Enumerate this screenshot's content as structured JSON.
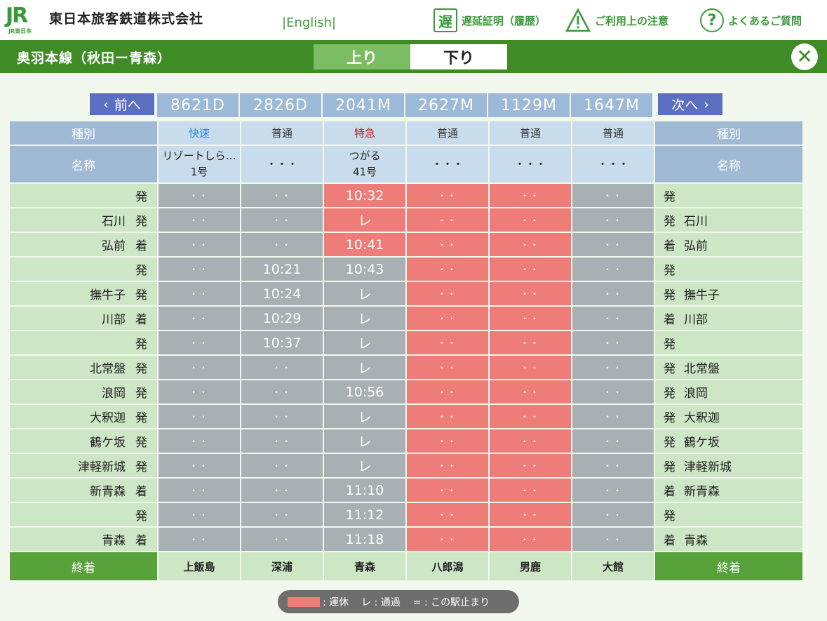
{
  "header": {
    "logo_text": "JR",
    "logo_sub": "JR東日本",
    "company": "東日本旅客鉄道株式会社",
    "english": "|English|",
    "links": [
      {
        "icon": "delay-certificate-icon",
        "glyph": "遅",
        "label": "遅延証明（履歴）"
      },
      {
        "icon": "warning-icon",
        "glyph": "!",
        "label": "ご利用上の注意"
      },
      {
        "icon": "help-icon",
        "glyph": "?",
        "label": "よくあるご質問"
      }
    ]
  },
  "linebar": {
    "line_name": "奥羽本線（秋田ー青森）",
    "tab_up": "上り",
    "tab_down": "下り",
    "close_glyph": "✕"
  },
  "nav": {
    "prev_label": "前へ",
    "prev_glyph": "‹",
    "next_label": "次へ",
    "next_glyph": "›"
  },
  "trains": [
    "8621D",
    "2826D",
    "2041M",
    "2627M",
    "1129M",
    "1647M"
  ],
  "table": {
    "kind_header": "種別",
    "name_header": "名称",
    "final_header": "終着",
    "kinds": [
      "快速",
      "普通",
      "特急",
      "普通",
      "普通",
      "普通"
    ],
    "names": [
      "リゾートしら…\n1号",
      "・・・",
      "つがる\n41号",
      "・・・",
      "・・・",
      "・・・"
    ],
    "rows": [
      {
        "station": "",
        "type": "発",
        "cells": [
          "・・",
          "・・",
          "10:32",
          "・・",
          "・・",
          "・・"
        ]
      },
      {
        "station": "石川",
        "type": "発",
        "cells": [
          "・・",
          "・・",
          "レ",
          "・・",
          "・・",
          "・・"
        ]
      },
      {
        "station": "弘前",
        "type": "着",
        "cells": [
          "・・",
          "・・",
          "10:41",
          "・・",
          "・・",
          "・・"
        ]
      },
      {
        "station": "",
        "type": "発",
        "cells": [
          "・・",
          "10:21",
          "10:43",
          "・・",
          "・・",
          "・・"
        ]
      },
      {
        "station": "撫牛子",
        "type": "発",
        "cells": [
          "・・",
          "10:24",
          "レ",
          "・・",
          "・・",
          "・・"
        ]
      },
      {
        "station": "川部",
        "type": "着",
        "cells": [
          "・・",
          "10:29",
          "レ",
          "・・",
          "・・",
          "・・"
        ]
      },
      {
        "station": "",
        "type": "発",
        "cells": [
          "・・",
          "10:37",
          "レ",
          "・・",
          "・・",
          "・・"
        ]
      },
      {
        "station": "北常盤",
        "type": "発",
        "cells": [
          "・・",
          "・・",
          "レ",
          "・・",
          "・・",
          "・・"
        ]
      },
      {
        "station": "浪岡",
        "type": "発",
        "cells": [
          "・・",
          "・・",
          "10:56",
          "・・",
          "・・",
          "・・"
        ]
      },
      {
        "station": "大釈迦",
        "type": "発",
        "cells": [
          "・・",
          "・・",
          "レ",
          "・・",
          "・・",
          "・・"
        ]
      },
      {
        "station": "鶴ケ坂",
        "type": "発",
        "cells": [
          "・・",
          "・・",
          "レ",
          "・・",
          "・・",
          "・・"
        ]
      },
      {
        "station": "津軽新城",
        "type": "発",
        "cells": [
          "・・",
          "・・",
          "レ",
          "・・",
          "・・",
          "・・"
        ]
      },
      {
        "station": "新青森",
        "type": "着",
        "cells": [
          "・・",
          "・・",
          "11:10",
          "・・",
          "・・",
          "・・"
        ]
      },
      {
        "station": "",
        "type": "発",
        "cells": [
          "・・",
          "・・",
          "11:12",
          "・・",
          "・・",
          "・・"
        ]
      },
      {
        "station": "青森",
        "type": "着",
        "cells": [
          "・・",
          "・・",
          "11:18",
          "・・",
          "・・",
          "・・"
        ]
      }
    ],
    "suspended_columns": [
      3,
      4
    ],
    "suspended_cells": [
      [
        0,
        2
      ],
      [
        1,
        2
      ],
      [
        2,
        2
      ]
    ],
    "destinations": [
      "上飯島",
      "深浦",
      "青森",
      "八郎潟",
      "男鹿",
      "大館"
    ]
  },
  "legend": {
    "suspended": ": 運休",
    "pass": "レ : 通過",
    "terminate": "= : この駅止まり"
  },
  "colors": {
    "green_bar": "#3f8c27",
    "suspended": "#ee7c78",
    "normal_cell": "#a9b0b3",
    "rapid": "#2a86d8",
    "limited_express": "#c4201c"
  }
}
